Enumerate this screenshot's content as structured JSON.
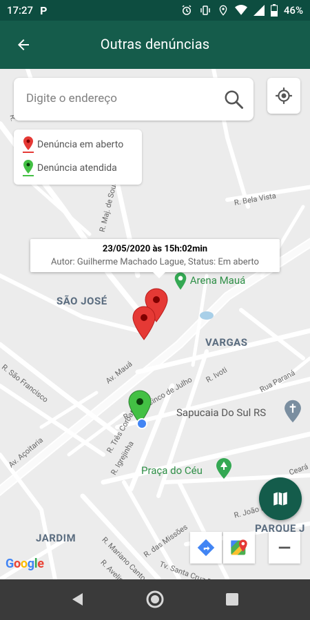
{
  "status_bar": {
    "time": "17:27",
    "carrier_icon": "P",
    "battery": "46%"
  },
  "app_bar": {
    "title": "Outras denúncias"
  },
  "search": {
    "placeholder": "Digite o endereço"
  },
  "legend": {
    "open_label": "Denúncia em aberto",
    "attended_label": "Denúncia atendida"
  },
  "info_window": {
    "line1": "23/05/2020 às 15h:02min",
    "line2": "Autor: Guilherme Machado Lague, Status: Em aberto"
  },
  "map_labels": {
    "sao_jose": "SÃO JOSÉ",
    "vargas": "VARGAS",
    "jardim": "JARDIM",
    "parque": "PARQUE J",
    "arena": "Arena Mauá",
    "sapucaia": "Sapucaia Do Sul RS",
    "praca": "Praça do Céu",
    "streets": {
      "maj": "R. Maj. de Sousa",
      "bela_vista": "R. Bela Vista",
      "av_maua": "Av. Mauá",
      "sao_francisco": "R. São Francisco",
      "cinco_julho": "R. Vinte Cinco de Julho",
      "ivoti": "R. Ivoti",
      "parana": "Rua Paraná",
      "acoitaria": "Av. Açoitaria",
      "tres_coroas": "R. Três Coroas",
      "igrejinha": "R. Igrejinha",
      "ceara": "Ceará",
      "joao_ramalho": "R. João Ramalho",
      "missoes": "R. das Missões",
      "mariano": "R. Mariano Canto",
      "avelino": "R. Avelino",
      "santa_cruz": "Tv. Santa Cruz B",
      "r_top": "R."
    }
  },
  "google_logo": "Google",
  "colors": {
    "primary": "#155c4b",
    "statusbar": "#0d4d40",
    "marker_open": "#e53935",
    "marker_attended": "#43a047"
  }
}
